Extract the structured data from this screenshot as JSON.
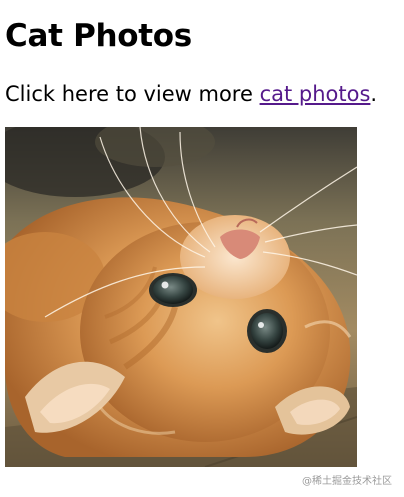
{
  "page": {
    "title": "Cat Photos",
    "intro_before": "Click here to view more ",
    "link_text": "cat photos",
    "intro_after": "."
  },
  "image": {
    "subject": "kitten",
    "colors": {
      "fur": "#d9954f",
      "background_top": "#3c3c36",
      "floor": "#7b6a4e"
    }
  },
  "watermark": {
    "text": "@稀土掘金技术社区"
  },
  "colors": {
    "link": "#551a8b",
    "text": "#000000",
    "background": "#ffffff"
  }
}
